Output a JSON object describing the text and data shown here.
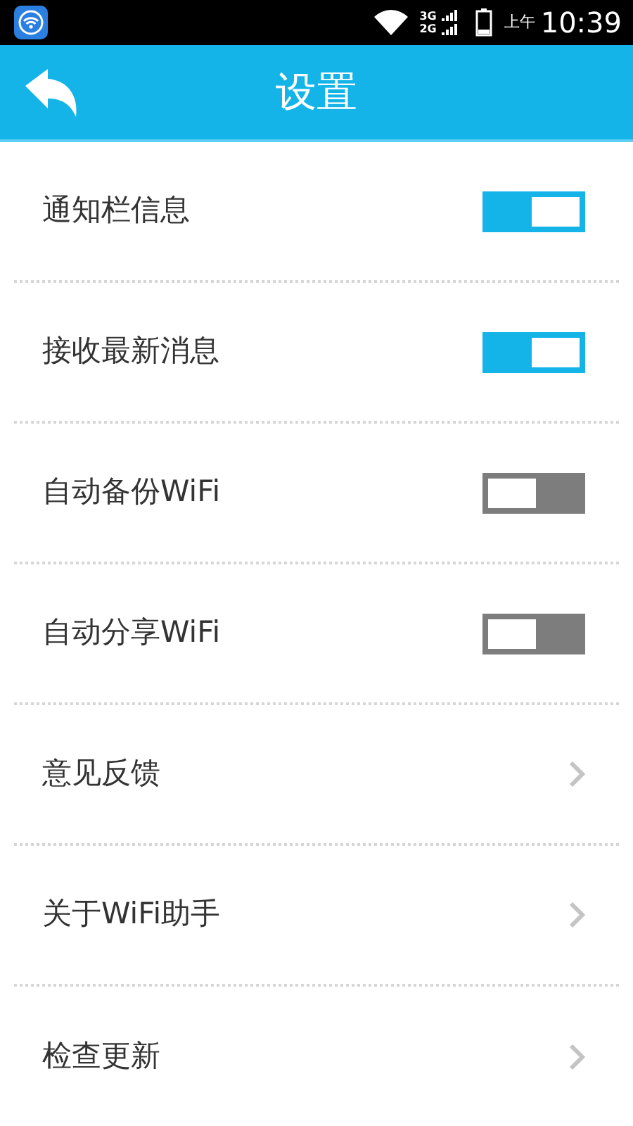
{
  "status_bar": {
    "network_1": "3G",
    "network_2": "2G",
    "am_pm": "上午",
    "time": "10:39"
  },
  "header": {
    "title": "设置"
  },
  "items": [
    {
      "kind": "toggle",
      "label": "通知栏信息",
      "on": true
    },
    {
      "kind": "toggle",
      "label": "接收最新消息",
      "on": true
    },
    {
      "kind": "toggle",
      "label": "自动备份WiFi",
      "on": false
    },
    {
      "kind": "toggle",
      "label": "自动分享WiFi",
      "on": false
    },
    {
      "kind": "link",
      "label": "意见反馈"
    },
    {
      "kind": "link",
      "label": "关于WiFi助手"
    },
    {
      "kind": "link",
      "label": "检查更新"
    }
  ]
}
